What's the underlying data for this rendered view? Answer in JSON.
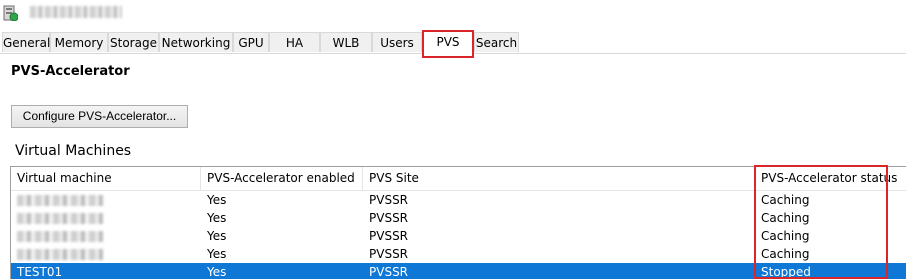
{
  "window": {
    "host_name": "",
    "host_icon": "server-icon"
  },
  "tabs": [
    {
      "label": "General"
    },
    {
      "label": "Memory"
    },
    {
      "label": "Storage"
    },
    {
      "label": "Networking"
    },
    {
      "label": "GPU"
    },
    {
      "label": "HA"
    },
    {
      "label": "WLB"
    },
    {
      "label": "Users"
    },
    {
      "label": "PVS",
      "active": true
    },
    {
      "label": "Search"
    }
  ],
  "page": {
    "title": "PVS-Accelerator",
    "configure_button": "Configure PVS-Accelerator...",
    "vm_section_title": "Virtual Machines"
  },
  "grid": {
    "columns": [
      "Virtual machine",
      "PVS-Accelerator enabled",
      "PVS Site",
      "PVS-Accelerator status"
    ],
    "rows": [
      {
        "vm": "",
        "enabled": "Yes",
        "site": "PVSSR",
        "status": "Caching",
        "vm_redacted": true
      },
      {
        "vm": "",
        "enabled": "Yes",
        "site": "PVSSR",
        "status": "Caching",
        "vm_redacted": true
      },
      {
        "vm": "",
        "enabled": "Yes",
        "site": "PVSSR",
        "status": "Caching",
        "vm_redacted": true
      },
      {
        "vm": "",
        "enabled": "Yes",
        "site": "PVSSR",
        "status": "Caching",
        "vm_redacted": true
      },
      {
        "vm": "TEST01",
        "enabled": "Yes",
        "site": "PVSSR",
        "status": "Stopped",
        "selected": true
      }
    ]
  },
  "colors": {
    "highlight_box": "#d9262b",
    "selection": "#0f77d6"
  }
}
